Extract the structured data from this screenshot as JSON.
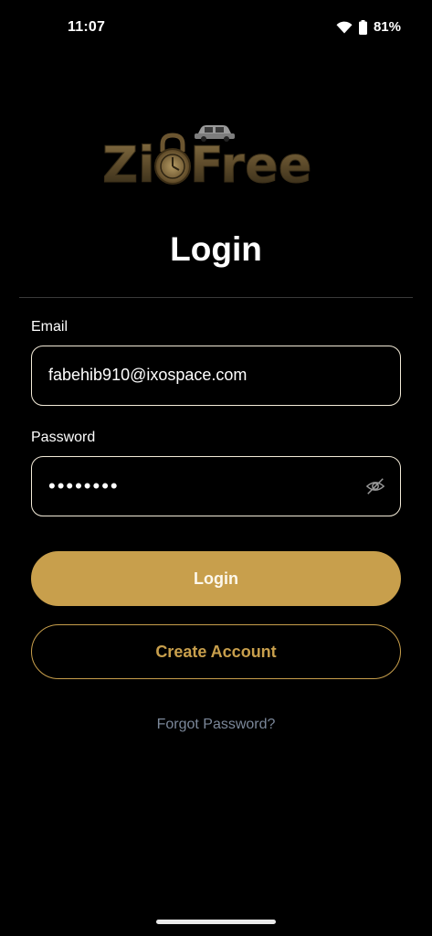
{
  "status_bar": {
    "time": "11:07",
    "battery": "81%",
    "wifi_icon": "wifi-icon",
    "battery_icon": "battery-icon"
  },
  "logo": {
    "text_left": "Zi",
    "text_right": "Free",
    "icon": "padlock-car-logo"
  },
  "page": {
    "title": "Login"
  },
  "form": {
    "email_label": "Email",
    "email_value": "fabehib910@ixospace.com",
    "password_label": "Password",
    "password_value": "••••••••",
    "password_toggle_icon": "eye-off-icon"
  },
  "actions": {
    "login_label": "Login",
    "create_account_label": "Create Account",
    "forgot_password_label": "Forgot Password?"
  },
  "colors": {
    "background": "#000000",
    "accent": "#c89f4c",
    "field_border": "#f2ead8",
    "link": "#7b8799"
  }
}
